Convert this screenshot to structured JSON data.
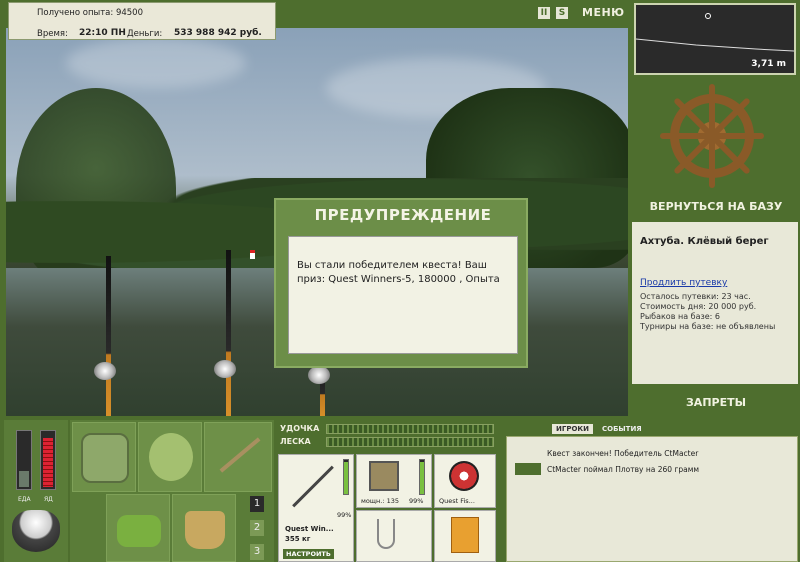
{
  "info": {
    "experience": "Получено опыта: 94500",
    "time_label": "Время:",
    "time_value": "22:10 ПН",
    "money_label": "Деньги:",
    "money_value": "533 988 942 руб."
  },
  "toolbar": {
    "pause_label": "II",
    "s_label": "S",
    "menu_label": "МЕНЮ"
  },
  "depth": {
    "value": "3,71 m"
  },
  "right_panel": {
    "return_base": "ВЕРНУТЬСЯ НА БАЗУ",
    "location": "Ахтуба. Клёвый берег",
    "extend_link": "Продлить путевку",
    "lines": [
      "Осталось путевки: 23 час.",
      "Стоимость дня: 20 000 руб.",
      "Рыбаков на базе: 6",
      "Турниры на базе: не объявлены"
    ],
    "bans": "ЗАПРЕТЫ"
  },
  "dialog": {
    "title": "ПРЕДУПРЕЖДЕНИЕ",
    "message": "Вы стали победителем квеста! Ваш приз: Quest Winners-5, 180000 , Опыта"
  },
  "status": {
    "food_label": "ЕДА",
    "poison_label": "ЯД",
    "food_level": 0.3,
    "poison_level": 0.9
  },
  "inventory": {
    "tabs": [
      "1",
      "2",
      "3"
    ]
  },
  "tackle": {
    "rod_label": "УДОЧКА",
    "line_label": "ЛЕСКА",
    "rod_name": "Quest Win...",
    "rod_weight": "355 кг",
    "rod_percent": "99%",
    "setup_button": "НАСТРОИТЬ",
    "reel_caption": "мощн.: 135",
    "reel_percent": "99%",
    "line_caption": "Quest Fis..."
  },
  "events": {
    "tab_players": "ИГРОКИ",
    "tab_events": "СОБЫТИЯ",
    "lines": [
      "Квест закончен! Победитель CtMacter",
      "CtMacter поймал Плотву на 260 грамм"
    ]
  }
}
